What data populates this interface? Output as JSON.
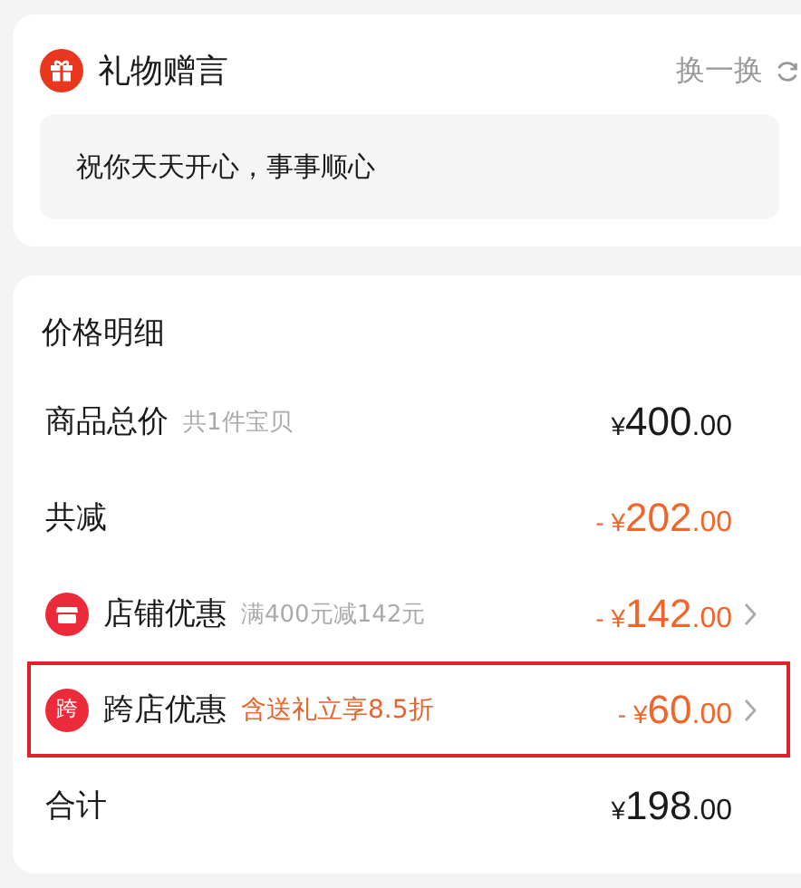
{
  "gift_message": {
    "title": "礼物赠言",
    "refresh_label": "换一换",
    "message": "祝你天天开心，事事顺心"
  },
  "price_details": {
    "title": "价格明细",
    "rows": [
      {
        "kind": "plain",
        "label": "商品总价",
        "note": "共1件宝贝",
        "discount": false,
        "highlighted": false,
        "sign": "",
        "currency": "¥",
        "integer": "400",
        "decimal": ".00"
      },
      {
        "kind": "plain",
        "label": "共减",
        "discount": true,
        "highlighted": false,
        "sign": "-",
        "currency": "¥",
        "integer": "202",
        "decimal": ".00"
      },
      {
        "kind": "shop",
        "label": "店铺优惠",
        "note": "满400元减142元",
        "discount": true,
        "highlighted": false,
        "sign": "-",
        "currency": "¥",
        "integer": "142",
        "decimal": ".00"
      },
      {
        "kind": "badge",
        "badge": "跨",
        "label": "跨店优惠",
        "promo": "含送礼立享8.5折",
        "discount": true,
        "highlighted": true,
        "sign": "-",
        "currency": "¥",
        "integer": "60",
        "decimal": ".00"
      },
      {
        "kind": "plain",
        "label": "合计",
        "discount": false,
        "highlighted": false,
        "sign": "",
        "currency": "¥",
        "integer": "198",
        "decimal": ".00"
      }
    ]
  }
}
